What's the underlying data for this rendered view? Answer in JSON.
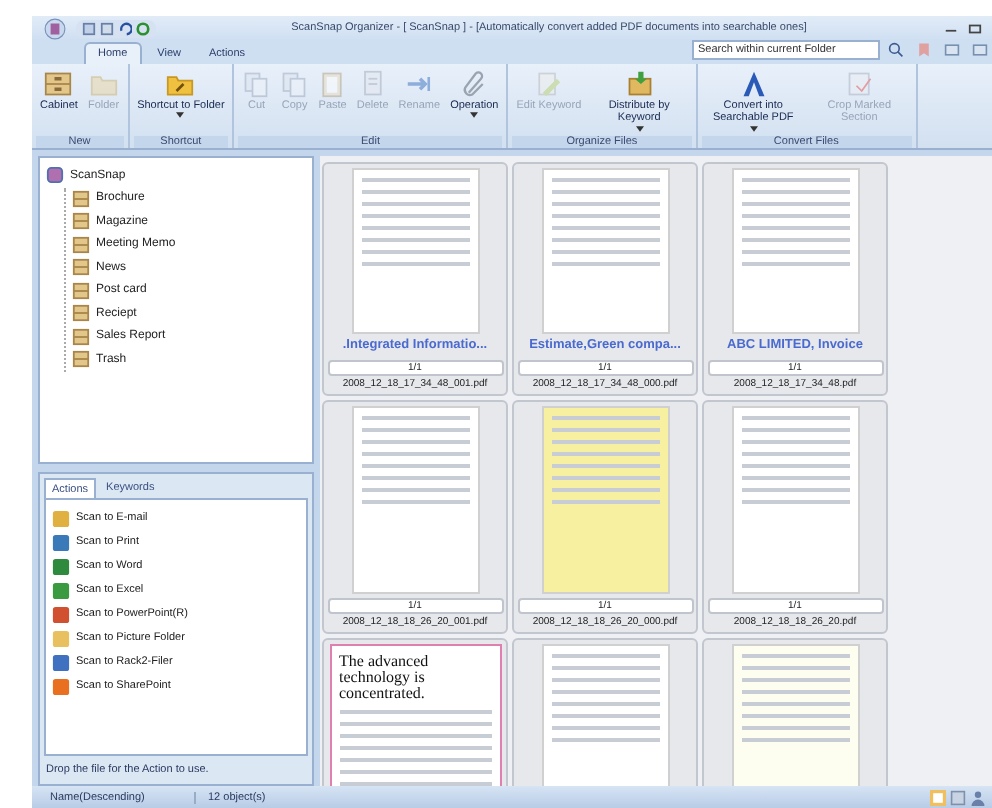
{
  "window": {
    "title": "ScanSnap Organizer - [ ScanSnap ] - [Automatically convert added PDF documents into searchable ones]"
  },
  "tabs": [
    {
      "label": "Home",
      "selected": true
    },
    {
      "label": "View",
      "selected": false
    },
    {
      "label": "Actions",
      "selected": false
    }
  ],
  "search": {
    "placeholder": "Search within current Folder"
  },
  "ribbon": {
    "groups": [
      {
        "label": "New",
        "buttons": [
          {
            "label": "Cabinet",
            "kind": "cabinet",
            "disabled": false,
            "dropdown": false
          },
          {
            "label": "Folder",
            "kind": "folder",
            "disabled": true,
            "dropdown": false
          }
        ]
      },
      {
        "label": "Shortcut",
        "buttons": [
          {
            "label": "Shortcut to Folder",
            "kind": "shortcut",
            "disabled": false,
            "dropdown": true
          }
        ]
      },
      {
        "label": "Edit",
        "buttons": [
          {
            "label": "Cut",
            "kind": "cut",
            "disabled": true,
            "dropdown": false
          },
          {
            "label": "Copy",
            "kind": "copy",
            "disabled": true,
            "dropdown": false
          },
          {
            "label": "Paste",
            "kind": "paste",
            "disabled": true,
            "dropdown": false
          },
          {
            "label": "Delete",
            "kind": "delete",
            "disabled": true,
            "dropdown": false
          },
          {
            "label": "Rename",
            "kind": "rename",
            "disabled": true,
            "dropdown": false
          },
          {
            "label": "Operation",
            "kind": "operation",
            "disabled": false,
            "dropdown": true
          }
        ]
      },
      {
        "label": "Organize Files",
        "buttons": [
          {
            "label": "Edit Keyword",
            "kind": "keyword",
            "disabled": true,
            "dropdown": false
          },
          {
            "label": "Distribute by Keyword",
            "kind": "distribute",
            "disabled": false,
            "dropdown": true
          }
        ]
      },
      {
        "label": "Convert Files",
        "buttons": [
          {
            "label": "Convert into Searchable PDF",
            "kind": "convert",
            "disabled": false,
            "dropdown": true
          },
          {
            "label": "Crop Marked Section",
            "kind": "crop",
            "disabled": true,
            "dropdown": false
          }
        ]
      }
    ]
  },
  "tree": {
    "label": "ScanSnap",
    "children": [
      {
        "label": "Brochure"
      },
      {
        "label": "Magazine"
      },
      {
        "label": "Meeting Memo"
      },
      {
        "label": "News"
      },
      {
        "label": "Post card"
      },
      {
        "label": "Reciept"
      },
      {
        "label": "Sales Report"
      },
      {
        "label": "Trash"
      }
    ]
  },
  "actions_panel": {
    "tabs": [
      {
        "label": "Actions",
        "selected": true
      },
      {
        "label": "Keywords",
        "selected": false
      }
    ],
    "items": [
      {
        "label": "Scan to E-mail",
        "color": "#e0b040"
      },
      {
        "label": "Scan to Print",
        "color": "#3a7ab8"
      },
      {
        "label": "Scan to Word",
        "color": "#2e8b3e"
      },
      {
        "label": "Scan to Excel",
        "color": "#3a9a40"
      },
      {
        "label": "Scan to PowerPoint(R)",
        "color": "#d05030"
      },
      {
        "label": "Scan to Picture Folder",
        "color": "#e8c060"
      },
      {
        "label": "Scan to Rack2-Filer",
        "color": "#4070c0"
      },
      {
        "label": "Scan to SharePoint",
        "color": "#e87020"
      }
    ],
    "hint": "Drop the file for the Action to use."
  },
  "documents": [
    {
      "title": ".Integrated Informatio...",
      "page": "1/1",
      "filename": "2008_12_18_17_34_48_001.pdf",
      "color": "#ffffff"
    },
    {
      "title": "Estimate,Green compa...",
      "page": "1/1",
      "filename": "2008_12_18_17_34_48_000.pdf",
      "color": "#ffffff"
    },
    {
      "title": "ABC LIMITED, Invoice",
      "page": "1/1",
      "filename": "2008_12_18_17_34_48.pdf",
      "color": "#ffffff"
    },
    {
      "page": "1/1",
      "filename": "2008_12_18_18_26_20_001.pdf",
      "color": "#ffffff"
    },
    {
      "page": "1/1",
      "filename": "2008_12_18_18_26_20_000.pdf",
      "color": "#f6f0a0"
    },
    {
      "page": "1/1",
      "filename": "2008_12_18_18_26_20.pdf",
      "color": "#ffffff"
    },
    {
      "headline": "The advanced technology is concentrated.",
      "color": "#ffffff"
    },
    {
      "color": "#ffffff"
    },
    {
      "color": "#fdfdf0"
    }
  ],
  "status_bar": {
    "sort": "Name(Descending)",
    "count": "12 object(s)"
  }
}
